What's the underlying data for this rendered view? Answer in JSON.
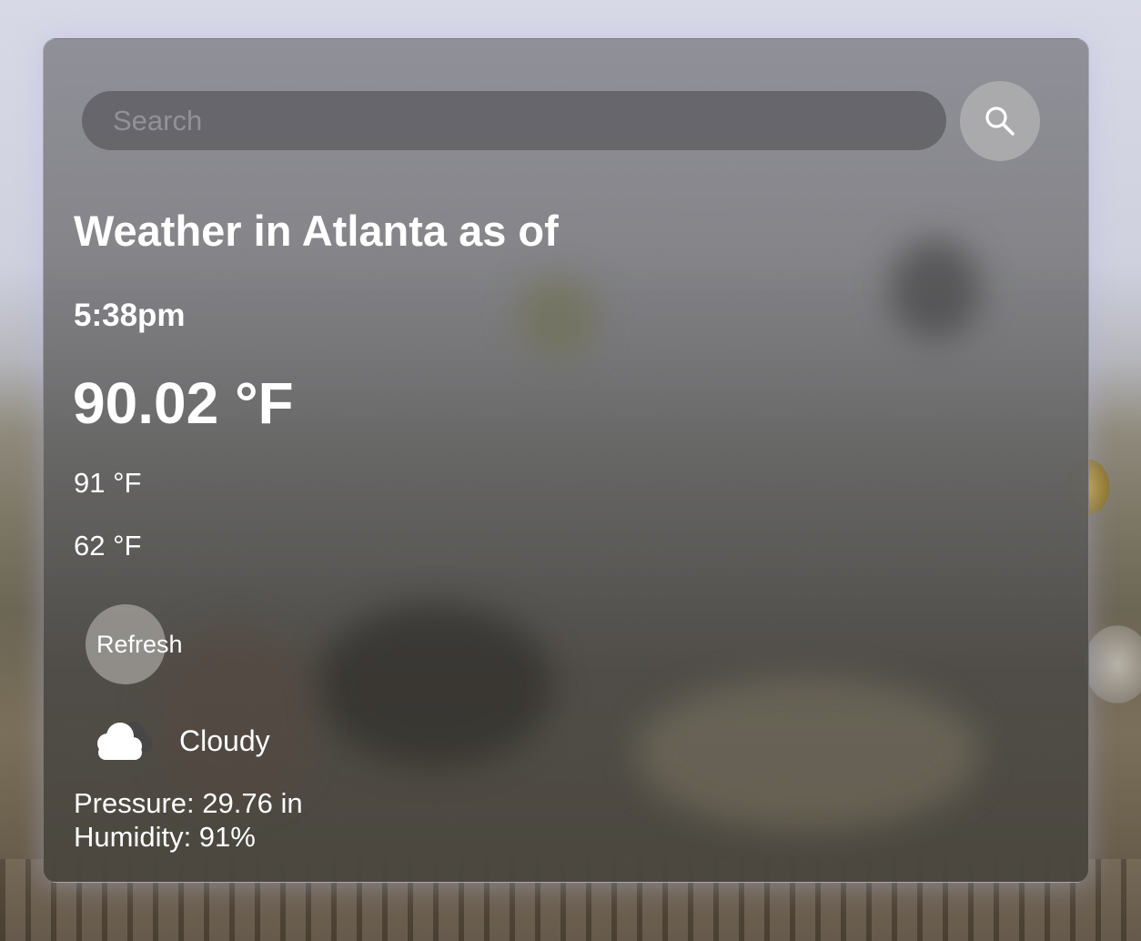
{
  "search": {
    "placeholder": "Search",
    "value": ""
  },
  "icons": {
    "search_button": "search-icon",
    "condition": "cloud-icon"
  },
  "weather": {
    "title": "Weather in Atlanta as of",
    "time": "5:38pm",
    "temperature": "90.02 °F",
    "high": "91 °F",
    "low": "62 °F",
    "condition": "Cloudy",
    "pressure": "Pressure: 29.76 in",
    "humidity": "Humidity: 91%"
  },
  "actions": {
    "refresh_label": "Refresh"
  },
  "colors": {
    "text": "#ffffff",
    "card_glow": "#b4b4e6"
  }
}
